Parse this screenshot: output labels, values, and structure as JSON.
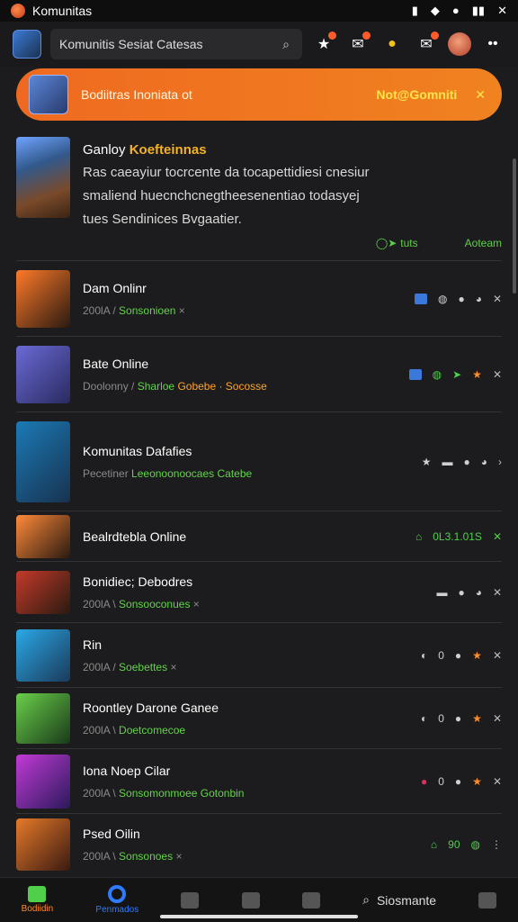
{
  "status": {
    "app_title": "Komunitas"
  },
  "topbar": {
    "search_text": "Komunitis Sesiat Catesas"
  },
  "banner": {
    "title": "Bodiitras Inoniata ot",
    "action": "Not@Gomniti"
  },
  "featured": {
    "title_prefix": "Ganloy",
    "title_highlight": "Koefteinnas",
    "desc1": "Ras caeayiur tocrcente da tocapettidiesi cnesiur",
    "desc2": "smaliend huecnchcnegtheesenentiao todasyej",
    "desc3": "tues Sendinices Bvgaatier.",
    "action1": "tuts",
    "action2": "Aoteam"
  },
  "rows": [
    {
      "name": "Dam Onlinr",
      "meta_a": "200lA /",
      "meta_b": "Sonsonioen",
      "meta_c": "×"
    },
    {
      "name": "Bate Online",
      "meta_a": "Doolonny /",
      "meta_b": "Sharloe",
      "meta_c": "Gobebe · Socosse"
    },
    {
      "name": "Komunitas Dafafies",
      "meta_a": "Pecetiner",
      "meta_b": "Leeonoonoocaes",
      "meta_c": "Catebe"
    },
    {
      "name": "Bealrdtebla Online",
      "meta_a": "",
      "meta_b": "",
      "meta_c": "0L3.1.01S"
    },
    {
      "name": "Bonidiec; Debodres",
      "meta_a": "200lA \\",
      "meta_b": "Sonsooconues",
      "meta_c": "×"
    },
    {
      "name": "Rin",
      "meta_a": "200lA /",
      "meta_b": "Soebettes",
      "meta_c": "×"
    },
    {
      "name": "Roontley Darone Ganee",
      "meta_a": "200lA \\",
      "meta_b": "Doetcomecoe",
      "meta_c": ""
    },
    {
      "name": "Iona Noep Cilar",
      "meta_a": "200lA \\",
      "meta_b": "Sonsomonmoee",
      "meta_c": "Gotonbin"
    },
    {
      "name": "Psed Oilin",
      "meta_a": "200lA \\",
      "meta_b": "Sonsonoes",
      "meta_c": "×"
    }
  ],
  "nav": {
    "home": "Bodiidin",
    "explore": "Penmados",
    "search": "Siosmante"
  },
  "colors": {
    "accent": "#ef6a20",
    "green": "#4fcf4a",
    "orange": "#ff8a2a"
  }
}
